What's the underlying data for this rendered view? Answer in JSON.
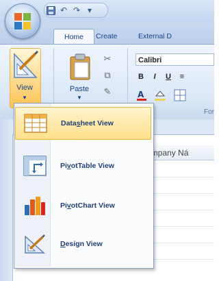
{
  "title_bar": {
    "quick_access": [
      "save",
      "undo",
      "redo",
      "customize"
    ]
  },
  "tabs": [
    {
      "label": "Home",
      "active": true
    },
    {
      "label": "Create",
      "active": false
    },
    {
      "label": "External D",
      "active": false
    }
  ],
  "ribbon": {
    "view": {
      "label": "View"
    },
    "clipboard": {
      "paste_label": "Paste"
    },
    "font": {
      "name": "Calibri",
      "format_buttons": [
        "B",
        "I",
        "U"
      ],
      "group_label": "For"
    }
  },
  "table": {
    "column_header": "ompany Ná"
  },
  "view_menu": {
    "items": [
      {
        "pre": "Data",
        "accel": "s",
        "post": "heet View",
        "icon": "datasheet-view-icon",
        "highlighted": true
      },
      {
        "pre": "Pi",
        "accel": "v",
        "post": "otTable View",
        "icon": "pivottable-view-icon",
        "highlighted": false
      },
      {
        "pre": "Pi",
        "accel": "v",
        "post": "otChart View",
        "icon": "pivotchart-view-icon",
        "highlighted": false
      },
      {
        "pre": "",
        "accel": "D",
        "post": "esign View",
        "icon": "design-view-icon",
        "highlighted": false
      }
    ]
  },
  "colors": {
    "highlight": "#ffe08a",
    "ribbon_text": "#15428b",
    "menu_text": "#1f3f77"
  }
}
